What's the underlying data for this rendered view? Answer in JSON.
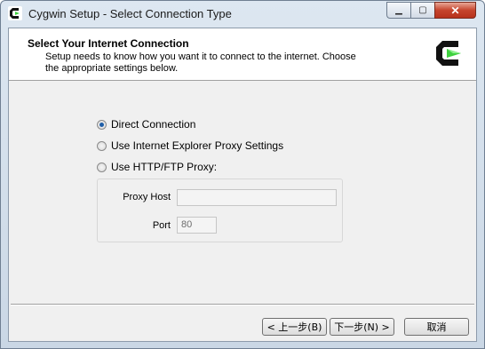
{
  "window": {
    "title": "Cygwin Setup - Select Connection Type"
  },
  "header": {
    "title": "Select Your Internet Connection",
    "description": "Setup needs to know how you want it to connect to the internet.  Choose the appropriate settings below."
  },
  "options": [
    {
      "label": "Direct Connection",
      "selected": true
    },
    {
      "label": "Use Internet Explorer Proxy Settings",
      "selected": false
    },
    {
      "label": "Use HTTP/FTP Proxy:",
      "selected": false
    }
  ],
  "proxy": {
    "host_label": "Proxy Host",
    "host_value": "",
    "port_label": "Port",
    "port_value": "80"
  },
  "buttons": {
    "back": "< 上一步(B)",
    "next": "下一步(N) >",
    "cancel": "取消"
  },
  "colors": {
    "accent_green": "#3fd13f",
    "logo_black": "#111111",
    "close_red": "#c6442d"
  }
}
